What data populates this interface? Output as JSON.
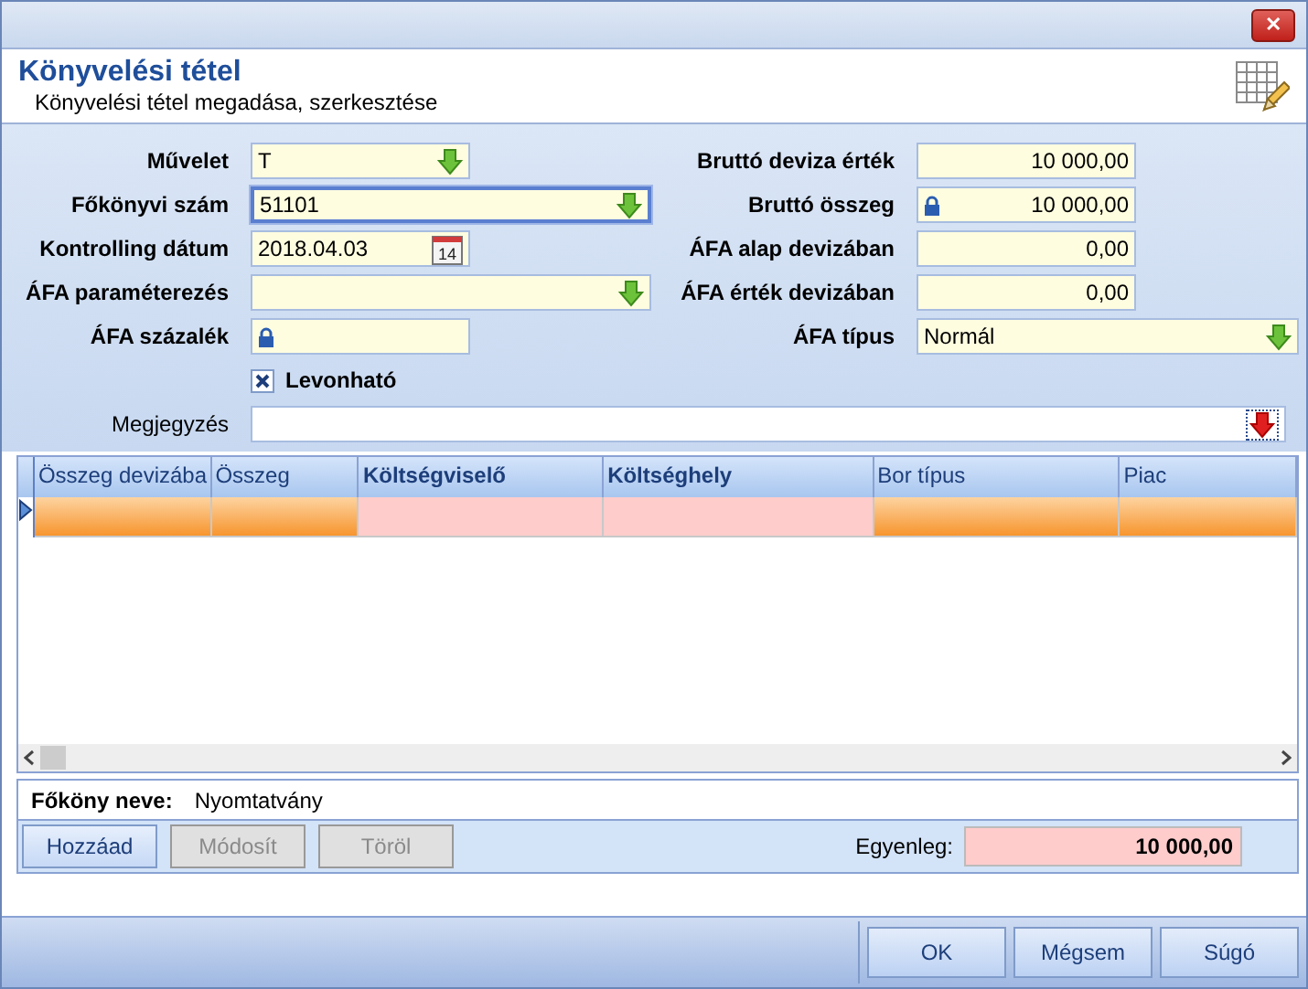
{
  "window": {
    "close": "✕"
  },
  "header": {
    "title": "Könyvelési tétel",
    "subtitle": "Könyvelési tétel megadása, szerkesztése"
  },
  "left_fields": [
    {
      "label": "Művelet",
      "value": "T",
      "kind": "dropdown",
      "locked": false,
      "focused": false
    },
    {
      "label": "Főkönyvi szám",
      "value": "51101",
      "kind": "dropdown",
      "locked": false,
      "focused": true
    },
    {
      "label": "Kontrolling dátum",
      "value": "2018.04.03",
      "kind": "date",
      "date_icon": "14",
      "locked": false,
      "focused": false
    },
    {
      "label": "ÁFA paraméterezés",
      "kind": "dropdown",
      "locked": false,
      "focused": false
    },
    {
      "label": "ÁFA százalék",
      "kind": "text",
      "locked": true,
      "focused": false
    }
  ],
  "right_fields": [
    {
      "label": "Bruttó deviza érték",
      "value": "10 000,00",
      "kind": "number",
      "locked": false
    },
    {
      "label": "Bruttó összeg",
      "value": "10 000,00",
      "kind": "number",
      "locked": true
    },
    {
      "label": "ÁFA alap devizában",
      "value": "0,00",
      "kind": "number",
      "locked": false
    },
    {
      "label": "ÁFA érték devizában",
      "value": "0,00",
      "kind": "number",
      "locked": false
    },
    {
      "label": "ÁFA típus",
      "value": "Normál",
      "kind": "dropdown",
      "locked": false
    }
  ],
  "checkbox": {
    "label": "Levonható",
    "checked": true
  },
  "note": {
    "label": "Megjegyzés"
  },
  "table": {
    "columns": [
      {
        "label": "Összeg devizába",
        "required": false
      },
      {
        "label": "Összeg",
        "required": false
      },
      {
        "label": "Költségviselő",
        "required": true
      },
      {
        "label": "Költséghely",
        "required": true
      },
      {
        "label": "Bor típus",
        "required": false
      },
      {
        "label": "Piac",
        "required": false
      }
    ],
    "rows": [
      {
        "selected": true
      }
    ]
  },
  "ledger": {
    "label": "Főköny neve:",
    "value": "Nyomtatvány"
  },
  "actions": [
    {
      "label": "Hozzáad",
      "disabled": false
    },
    {
      "label": "Módosít",
      "disabled": true
    },
    {
      "label": "Töröl",
      "disabled": true
    }
  ],
  "balance": {
    "label": "Egyenleg:",
    "value": "10 000,00"
  },
  "buttons": [
    "OK",
    "Mégsem",
    "Súgó"
  ]
}
